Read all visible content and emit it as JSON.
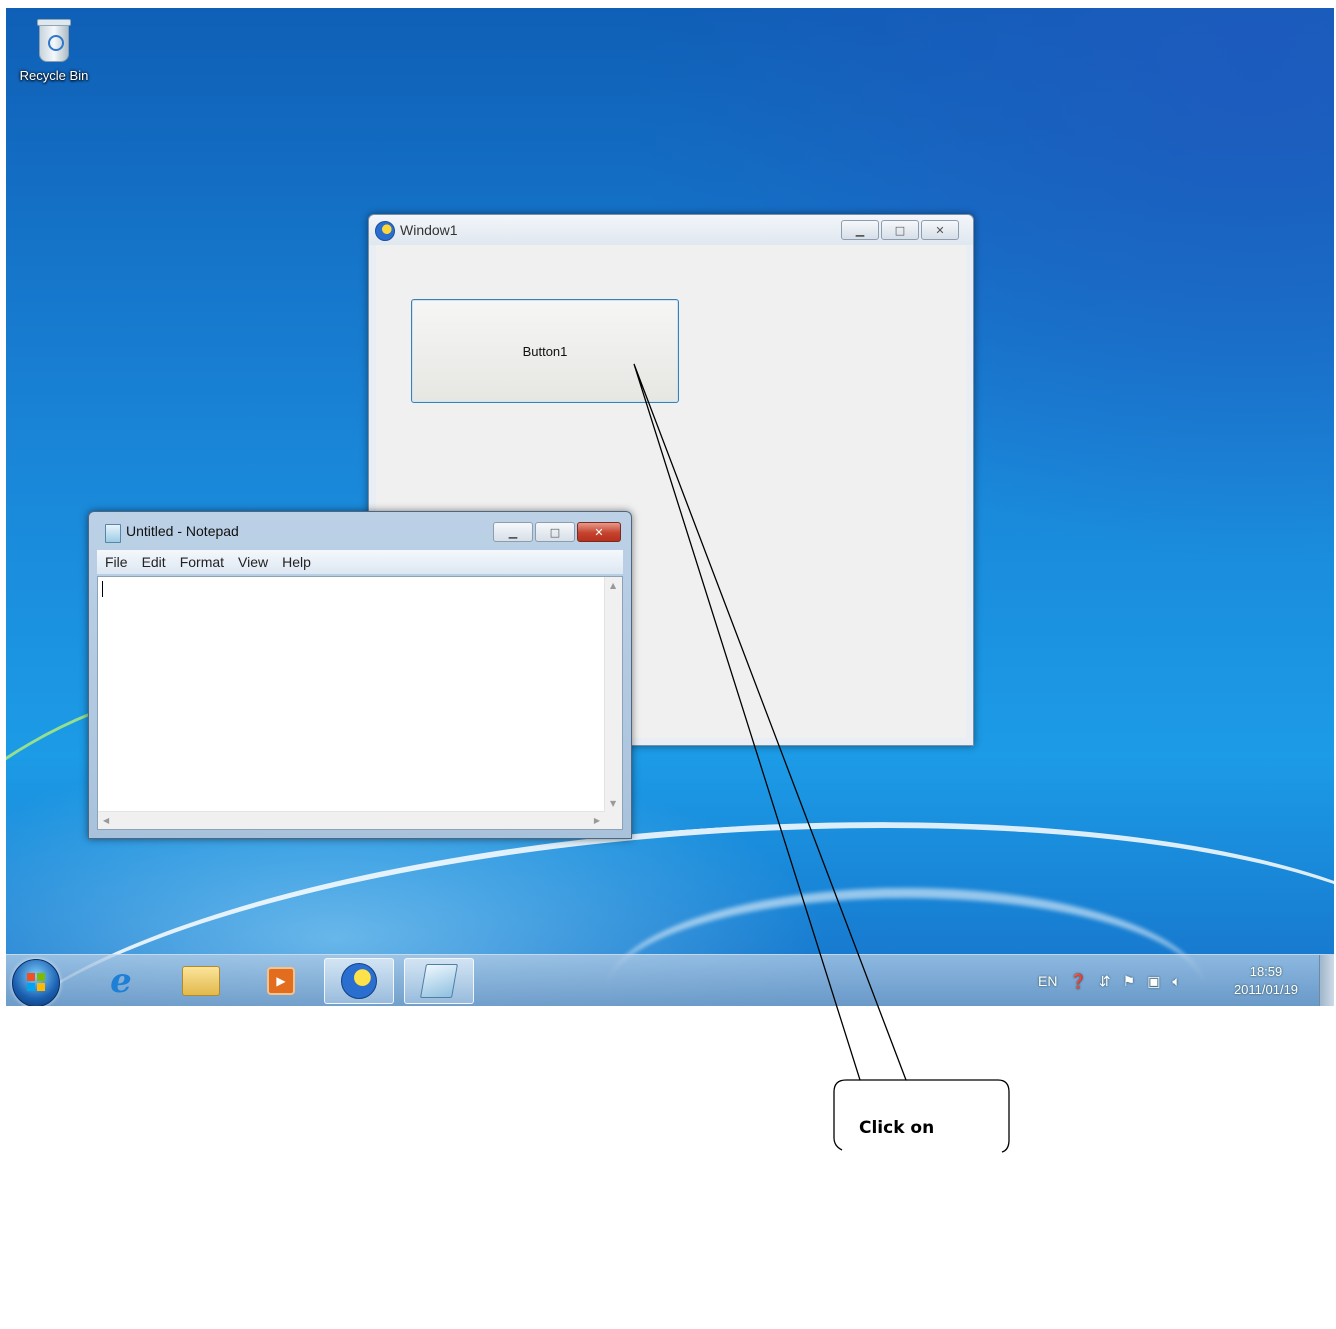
{
  "desktop": {
    "icons": [
      {
        "label": "Recycle Bin",
        "icon": "recycle-bin-icon"
      }
    ]
  },
  "window1": {
    "title": "Window1",
    "button_label": "Button1"
  },
  "notepad": {
    "title": "Untitled - Notepad",
    "menu": [
      "File",
      "Edit",
      "Format",
      "View",
      "Help"
    ],
    "content": ""
  },
  "taskbar": {
    "pinned": [
      "start-orb",
      "internet-explorer-icon",
      "windows-explorer-icon",
      "media-player-icon",
      "window1-app-icon",
      "notepad-app-icon"
    ],
    "tray": {
      "language": "EN",
      "icons": [
        "help-icon",
        "network-expand-icon",
        "action-center-flag-icon",
        "network-icon",
        "volume-icon"
      ]
    },
    "clock": {
      "time": "18:59",
      "date": "2011/01/19"
    }
  },
  "callout": {
    "text": "Click on"
  }
}
